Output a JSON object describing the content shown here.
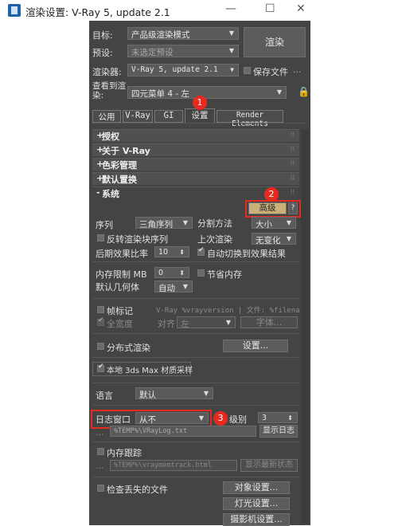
{
  "window": {
    "title": "渲染设置: V-Ray 5, update 2.1",
    "minimize": "—",
    "maximize": "☐",
    "close": "✕"
  },
  "top": {
    "target_label": "目标:",
    "target_value": "产品级渲染模式",
    "preset_label": "预设:",
    "preset_value": "未选定预设",
    "renderer_label": "渲染器:",
    "renderer_value": "V-Ray 5, update 2.1",
    "save_file_label": "保存文件",
    "more": "...",
    "render_button": "渲染",
    "view_label": "查看到渲染:",
    "view_value": "四元菜单 4 - 左"
  },
  "tabs": [
    "公用",
    "V-Ray",
    "GI",
    "设置",
    "Render Elements"
  ],
  "rollouts": [
    {
      "label": "授权",
      "sign": "+"
    },
    {
      "label": "关于 V-Ray",
      "sign": "+"
    },
    {
      "label": "色彩管理",
      "sign": "+"
    },
    {
      "label": "默认置换",
      "sign": "+"
    },
    {
      "label": "系统",
      "sign": "-"
    }
  ],
  "system": {
    "advanced_button": "高级",
    "help": "?",
    "sequence_label": "序列",
    "sequence_value": "三角序列",
    "divide_label": "分割方法",
    "divide_value": "大小",
    "reverse_label": "反转渲染块序列",
    "last_render_label": "上次渲染",
    "last_render_value": "无变化",
    "post_ratio_label": "后期效果比率",
    "post_ratio_value": "10",
    "auto_switch_label": "自动切换到效果结果",
    "mem_limit_label": "内存限制 MB",
    "mem_limit_value": "0",
    "save_mem_label": "节省内存",
    "default_geo_label": "默认几何体",
    "default_geo_value": "自动",
    "frame_stamp_label": "帧标记",
    "frame_stamp_text": "V-Ray %vrayversion | 文件: %filename",
    "full_width_label": "全宽度",
    "align_label": "对齐",
    "align_value": "左",
    "font_button": "字体...",
    "distributed_label": "分布式渲染",
    "distributed_button": "设置...",
    "local_3ds_label": "本地 3ds Max 材质采样",
    "language_label": "语言",
    "language_value": "默认",
    "log_window_label": "日志窗口",
    "log_window_value": "从不",
    "log_level_label": "级别",
    "log_level_value": "3",
    "log_path": "%TEMP%\\VRayLog.txt",
    "show_log_button": "显示日志",
    "mem_track_label": "内存跟踪",
    "mem_track_path": "%TEMP%\\vraymemtrack.html",
    "show_latest_button": "显示最新状态",
    "check_missing_label": "检查丢失的文件",
    "object_settings_button": "对象设置...",
    "light_settings_button": "灯光设置...",
    "camera_settings_button": "摄影机设置..."
  },
  "annotations": [
    "1",
    "2",
    "3"
  ],
  "colors": {
    "panel": "#444444",
    "annotation": "#e8291f",
    "advanced_button_bg": "#c9b07a"
  }
}
